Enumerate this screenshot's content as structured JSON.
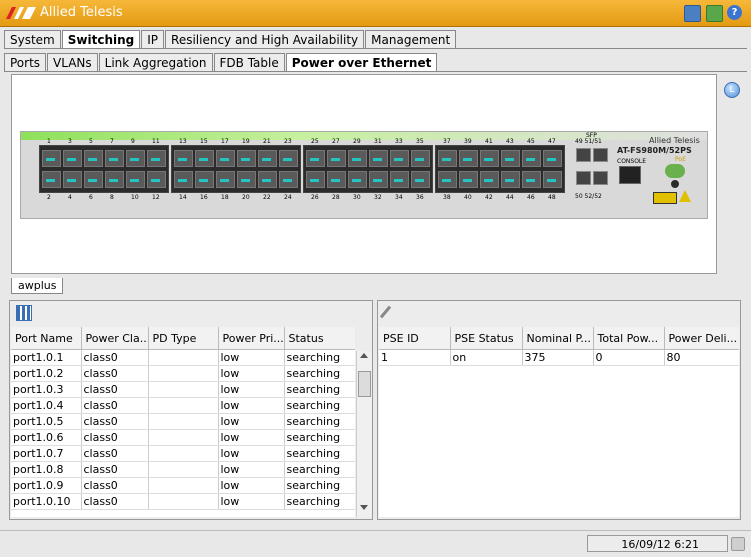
{
  "app": {
    "title": "Allied Telesis",
    "logo_text": "AT"
  },
  "main_tabs": [
    {
      "label": "System"
    },
    {
      "label": "Switching"
    },
    {
      "label": "IP"
    },
    {
      "label": "Resiliency and High Availability"
    },
    {
      "label": "Management"
    }
  ],
  "sub_tabs": [
    {
      "label": "Ports"
    },
    {
      "label": "VLANs"
    },
    {
      "label": "Link Aggregation"
    },
    {
      "label": "FDB Table"
    },
    {
      "label": "Power over Ethernet"
    }
  ],
  "device": {
    "brand": "Allied Telesis",
    "model": "AT-FS980M/52PS",
    "poe_label": "PoE",
    "console_label": "CONSOLE",
    "sfp_label": "SFP",
    "top_numbers": [
      "1",
      "3",
      "5",
      "7",
      "9",
      "11",
      "13",
      "15",
      "17",
      "19",
      "21",
      "23",
      "25",
      "27",
      "29",
      "31",
      "33",
      "35",
      "37",
      "39",
      "41",
      "43",
      "45",
      "47"
    ],
    "bottom_numbers": [
      "2",
      "4",
      "6",
      "8",
      "10",
      "12",
      "14",
      "16",
      "18",
      "20",
      "22",
      "24",
      "26",
      "28",
      "30",
      "32",
      "34",
      "36",
      "38",
      "40",
      "42",
      "44",
      "46",
      "48"
    ],
    "sfp_top": "49 51/51",
    "sfp_bottom": "50 52/52"
  },
  "switch_tab": {
    "label": "awplus"
  },
  "ports_table": {
    "columns": [
      "Port Name",
      "Power Cla...",
      "PD Type",
      "Power Pri...",
      "Status"
    ],
    "rows": [
      [
        "port1.0.1",
        "class0",
        "",
        "low",
        "searching"
      ],
      [
        "port1.0.2",
        "class0",
        "",
        "low",
        "searching"
      ],
      [
        "port1.0.3",
        "class0",
        "",
        "low",
        "searching"
      ],
      [
        "port1.0.4",
        "class0",
        "",
        "low",
        "searching"
      ],
      [
        "port1.0.5",
        "class0",
        "",
        "low",
        "searching"
      ],
      [
        "port1.0.6",
        "class0",
        "",
        "low",
        "searching"
      ],
      [
        "port1.0.7",
        "class0",
        "",
        "low",
        "searching"
      ],
      [
        "port1.0.8",
        "class0",
        "",
        "low",
        "searching"
      ],
      [
        "port1.0.9",
        "class0",
        "",
        "low",
        "searching"
      ],
      [
        "port1.0.10",
        "class0",
        "",
        "low",
        "searching"
      ]
    ]
  },
  "pse_table": {
    "columns": [
      "PSE ID",
      "PSE Status",
      "Nominal P...",
      "Total Pow...",
      "Power Deli..."
    ],
    "rows": [
      [
        "1",
        "on",
        "375",
        "0",
        "80"
      ]
    ]
  },
  "status": {
    "datetime": "16/09/12 6:21"
  },
  "colors": {
    "titlebar": "#f0a820",
    "led": "#27c3c0",
    "chassis_accent": "#8ee15a"
  }
}
